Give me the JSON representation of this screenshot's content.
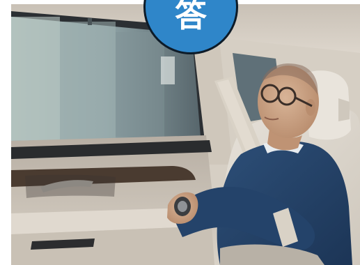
{
  "badge": {
    "glyph": "答",
    "color": "#2f86c9",
    "border_color": "#0d1b28"
  },
  "photo": {
    "subject": "man-resting-in-car-rear-seat"
  }
}
